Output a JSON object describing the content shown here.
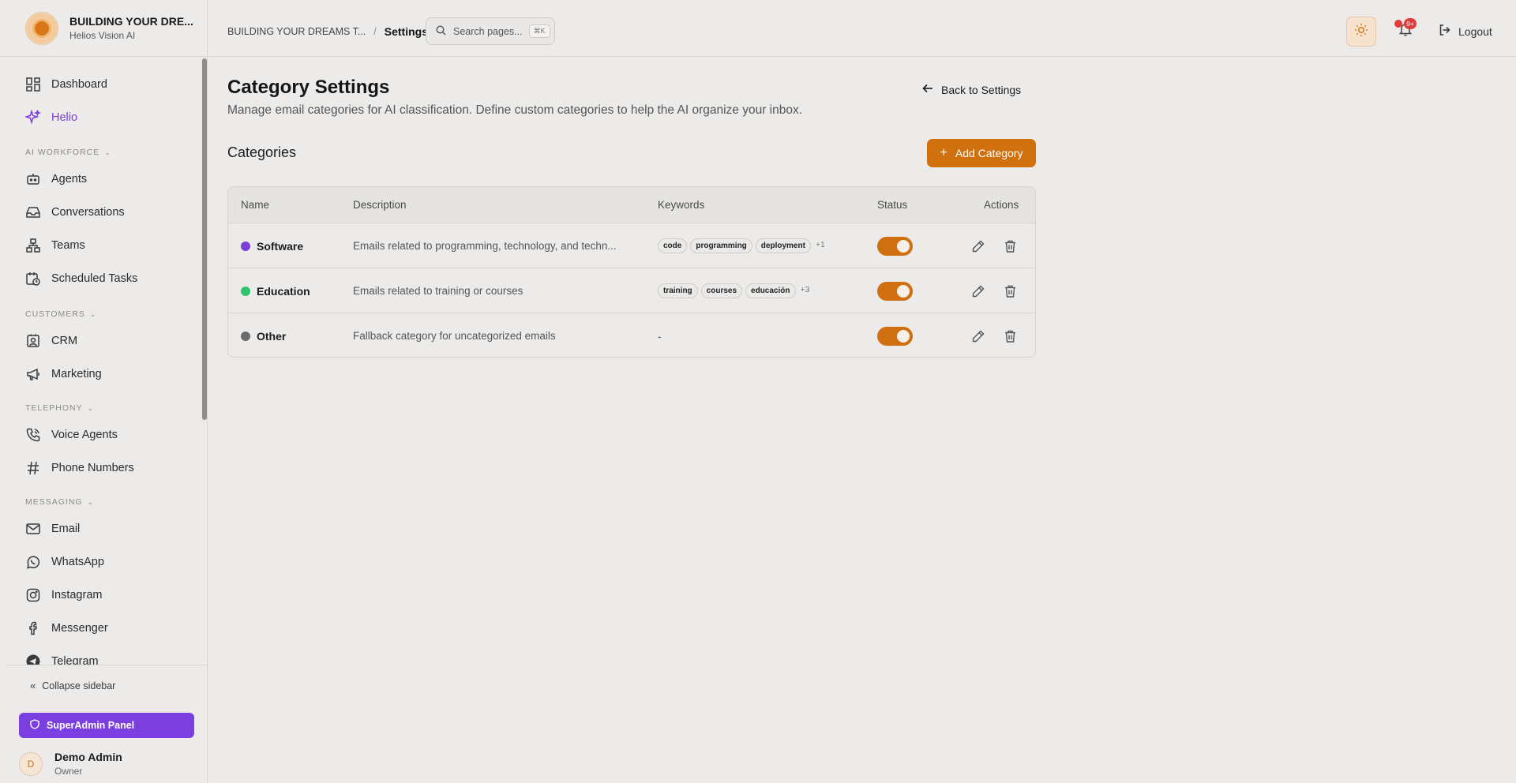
{
  "app": {
    "title": "BUILDING YOUR DRE...",
    "subtitle": "Helios Vision AI"
  },
  "sidebar": {
    "items": [
      {
        "label": "Dashboard",
        "icon": "dashboard-icon"
      },
      {
        "label": "Helio",
        "icon": "sparkles-icon",
        "active": true
      },
      {
        "label": "Agents",
        "icon": "robot-icon"
      },
      {
        "label": "Conversations",
        "icon": "inbox-icon"
      },
      {
        "label": "Teams",
        "icon": "network-icon"
      },
      {
        "label": "Scheduled Tasks",
        "icon": "calendar-clock-icon"
      },
      {
        "label": "CRM",
        "icon": "contact-icon"
      },
      {
        "label": "Marketing",
        "icon": "megaphone-icon"
      },
      {
        "label": "Voice Agents",
        "icon": "phone-icon"
      },
      {
        "label": "Phone Numbers",
        "icon": "hash-icon"
      },
      {
        "label": "Email",
        "icon": "mail-icon"
      },
      {
        "label": "WhatsApp",
        "icon": "whatsapp-icon"
      },
      {
        "label": "Instagram",
        "icon": "instagram-icon"
      },
      {
        "label": "Messenger",
        "icon": "facebook-icon"
      },
      {
        "label": "Telegram",
        "icon": "telegram-icon"
      }
    ],
    "sections": {
      "ai_workforce": "AI WORKFORCE",
      "customers": "CUSTOMERS",
      "telephony": "TELEPHONY",
      "messaging": "MESSAGING"
    },
    "collapse_label": "Collapse sidebar",
    "superadmin_label": "SuperAdmin Panel",
    "user": {
      "initial": "D",
      "name": "Demo Admin",
      "role": "Owner"
    }
  },
  "header": {
    "breadcrumb_parent": "BUILDING YOUR DREAMS T...",
    "breadcrumb_sep": "/",
    "breadcrumb_current": "Settings",
    "search_placeholder": "Search pages...",
    "search_shortcut": "⌘K",
    "notification_badge": "9+",
    "logout_label": "Logout"
  },
  "main": {
    "title": "Category Settings",
    "description": "Manage email categories for AI classification. Define custom categories to help the AI organize your inbox.",
    "back_label": "Back to Settings",
    "section_title": "Categories",
    "add_label": "Add Category",
    "columns": [
      "Name",
      "Description",
      "Keywords",
      "Status",
      "Actions"
    ],
    "rows": [
      {
        "name": "Software",
        "color": "#7a3fd8",
        "description": "Emails related to programming, technology, and techn...",
        "keywords": [
          "code",
          "programming",
          "deployment"
        ],
        "more": "+1",
        "enabled": true
      },
      {
        "name": "Education",
        "color": "#2fc46b",
        "description": "Emails related to training or courses",
        "keywords": [
          "training",
          "courses",
          "educación"
        ],
        "more": "+3",
        "enabled": true
      },
      {
        "name": "Other",
        "color": "#6b6b6b",
        "description": "Fallback category for uncategorized emails",
        "keywords": [],
        "no_keywords": "-",
        "enabled": true
      }
    ]
  },
  "colors": {
    "accent": "#d0700f",
    "purple": "#7b3fe0",
    "background": "#ecebe9"
  }
}
